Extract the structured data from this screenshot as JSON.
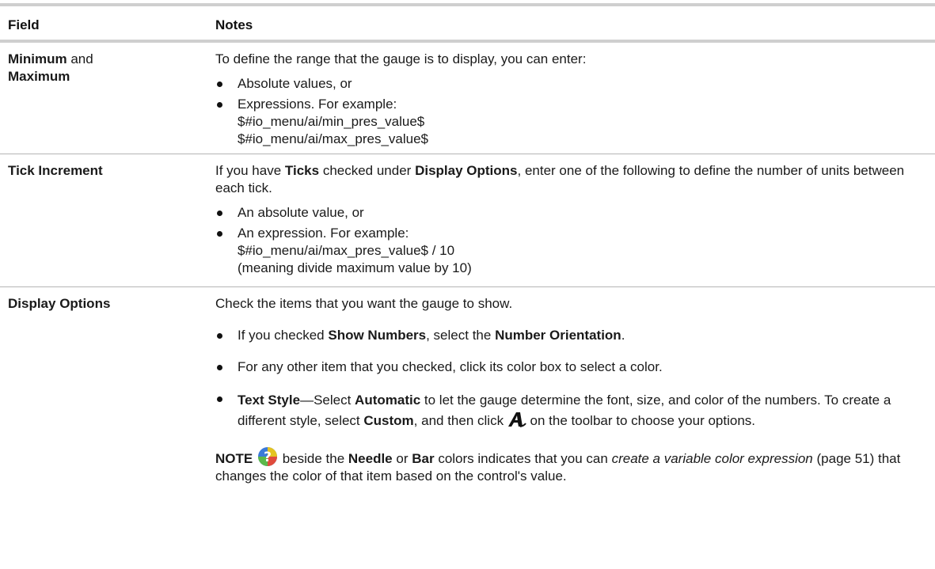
{
  "header": {
    "field": "Field",
    "notes": "Notes"
  },
  "rows": [
    {
      "field_a": "Minimum",
      "field_and": "and",
      "field_b": "Maximum",
      "intro": "To define the range that the gauge is to display, you can enter:",
      "bullet1": "Absolute values, or",
      "bullet2": "Expressions. For example:",
      "expr1": "$#io_menu/ai/min_pres_value$",
      "expr2": "$#io_menu/ai/max_pres_value$"
    },
    {
      "field": "Tick Increment",
      "intro_a": "If you have",
      "ticks": "Ticks",
      "intro_b": "checked under",
      "display_options": "Display Options",
      "intro_c": ", enter one of the following to define the number of units between each tick.",
      "bullet1": "An absolute value, or",
      "bullet2": "An expression. For example:",
      "expr": "$#io_menu/ai/max_pres_value$ / 10",
      "meaning": "(meaning divide maximum value by 10)"
    },
    {
      "field": "Display Options",
      "intro": "Check the items that you want the gauge to show.",
      "b1_a": "If you checked",
      "b1_show_numbers": "Show Numbers",
      "b1_b": ", select the",
      "b1_orientation": "Number Orientation",
      "b1_c": ".",
      "b2": "For any other item that you checked, click its color box to select a color.",
      "b3_text_style": "Text Style",
      "b3_a": "—Select",
      "b3_automatic": "Automatic",
      "b3_b": "to let the gauge determine the font, size, and color of the numbers. To create a different style, select",
      "b3_custom": "Custom",
      "b3_c": ", and then click",
      "b3_d": "on the toolbar to choose your options.",
      "note_label": "NOTE",
      "note_a": "beside the",
      "note_needle": "Needle",
      "note_or": "or",
      "note_bar": "Bar",
      "note_b": "colors indicates that you can",
      "note_link": "create a variable color expression",
      "note_page": "(page 51) that changes the color of that item based on the control's value."
    }
  ],
  "icons": {
    "text_style_icon": "font-style-A-icon",
    "variable_color_icon": "help-question-icon"
  }
}
